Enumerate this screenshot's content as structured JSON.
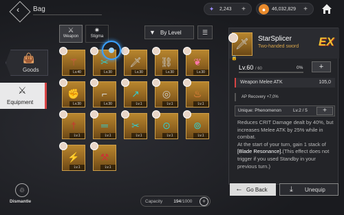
{
  "header": {
    "title": "Bag",
    "currency1": {
      "value": "2,243",
      "icon": "butterfly-icon",
      "color": "#7a6cff"
    },
    "currency2": {
      "value": "46,032,829",
      "icon": "coin-icon",
      "color": "#e98a2c"
    }
  },
  "nav": {
    "goods": "Goods",
    "equipment": "Equipment",
    "dismantle": "Dismantle"
  },
  "filters": {
    "weapon": "Weapon",
    "stigma": "Stigma",
    "sort": "By Level"
  },
  "grid": {
    "items": [
      {
        "level": "Lv.40",
        "icon": "staff-icon",
        "color": "#e05050"
      },
      {
        "level": "Lv.30",
        "icon": "blade-icon",
        "color": "#3cc"
      },
      {
        "level": "Lv.30",
        "icon": "sword-icon",
        "color": "#ccc"
      },
      {
        "level": "Lv.30",
        "icon": "chain-icon",
        "color": "#ccc"
      },
      {
        "level": "Lv.30",
        "icon": "gun-icon",
        "color": "#f7a"
      },
      {
        "level": "Lv.30",
        "icon": "gauntlet-icon",
        "color": "#ccc"
      },
      {
        "level": "Lv.30",
        "icon": "pistol-icon",
        "color": "#ddd"
      },
      {
        "level": "Lv.1",
        "icon": "spear-icon",
        "color": "#3cc"
      },
      {
        "level": "Lv.1",
        "icon": "ring-blade-icon",
        "color": "#ccc"
      },
      {
        "level": "Lv.1",
        "icon": "flame-icon",
        "color": "#f84"
      },
      {
        "level": "Lv.1",
        "icon": "dagger-icon",
        "color": "#c33"
      },
      {
        "level": "Lv.1",
        "icon": "rifle-icon",
        "color": "#3cc"
      },
      {
        "level": "Lv.1",
        "icon": "blade-icon",
        "color": "#3cc"
      },
      {
        "level": "Lv.1",
        "icon": "disc-icon",
        "color": "#3cc"
      },
      {
        "level": "Lv.1",
        "icon": "cannon-icon",
        "color": "#3cc"
      },
      {
        "level": "Lv.1",
        "icon": "claw-icon",
        "color": "#ccc"
      },
      {
        "level": "Lv.1",
        "icon": "axe-icon",
        "color": "#c33"
      }
    ]
  },
  "capacity": {
    "label": "Capacity",
    "current": "194",
    "total": "/1000"
  },
  "detail": {
    "name": "StarSplicer",
    "type": "Two-handed sword",
    "rank": "EX",
    "level": "Lv.60",
    "level_max": "/ 60",
    "exp_pct": "0%",
    "exp_fraction": 0,
    "main_stat_label": "Weapon Melee ATK",
    "main_stat_value": "105,0",
    "sub_stat": "AP Recovery +7,0%",
    "unique_label": "Unique: Phenomenon",
    "unique_lv": "Lv.2 / 5",
    "desc1": "Reduces CRIT Damage dealt by 40%, but increases Melee ATK by 25% while in combat.",
    "desc2a": "At the start of your turn, gain 1 stack of ",
    "desc2b": "[Blade Resonance].",
    "desc2c": "(This effect does not trigger if you used Standby in your previous turn.)",
    "go_back": "Go Back",
    "unequip": "Unequip"
  }
}
